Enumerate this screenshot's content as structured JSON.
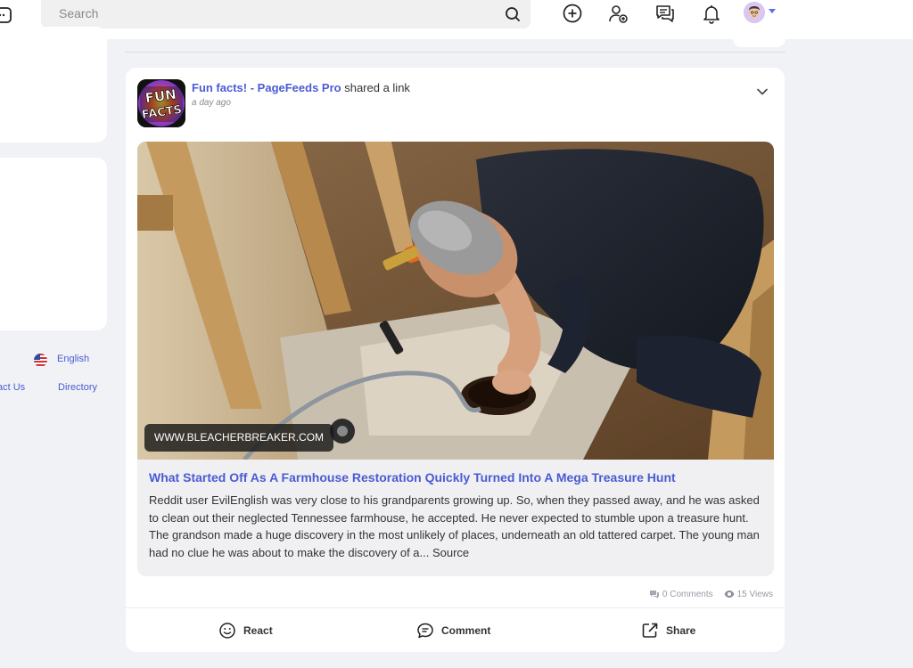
{
  "topbar": {
    "search_placeholder": "Search",
    "icons": [
      "create-icon",
      "add-friend-icon",
      "messages-icon",
      "notifications-icon"
    ]
  },
  "sidebar": {
    "language_label": "English",
    "contact_label": "act Us",
    "directory_label": "Directory"
  },
  "post": {
    "author": "Fun facts! - PageFeeds Pro",
    "action_text": "shared a link",
    "time": "a day ago",
    "page_logo_text": [
      "FUN",
      "FACTS"
    ],
    "link": {
      "domain": "WWW.BLEACHERBREAKER.COM",
      "title": "What Started Off As A Farmhouse Restoration Quickly Turned Into A Mega Treasure Hunt",
      "description": "Reddit user EvilEnglish was very close to his grandparents growing up. So, when they passed away, and he was asked to clean out their neglected Tennessee farmhouse, he accepted. He never expected to stumble upon a treasure hunt. The grandson made a huge discovery in the most unlikely of places, underneath an old tattered carpet. The young man had no clue he was about to make the discovery of a... Source"
    },
    "stats": {
      "comments": "0 Comments",
      "views": "15 Views"
    },
    "actions": {
      "react": "React",
      "comment": "Comment",
      "share": "Share"
    }
  },
  "colors": {
    "accent": "#4a5bd4",
    "background": "#f0f2f5",
    "card": "#ffffff"
  }
}
